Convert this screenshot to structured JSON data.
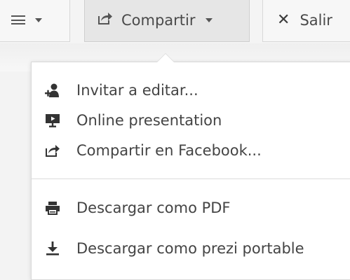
{
  "toolbar": {
    "share_label": "Compartir",
    "exit_label": "Salir"
  },
  "share_menu": {
    "items": [
      {
        "label": "Invitar a editar...",
        "icon": "add-user-icon"
      },
      {
        "label": "Online presentation",
        "icon": "presentation-screen-icon"
      },
      {
        "label": "Compartir en Facebook...",
        "icon": "share-icon"
      },
      {
        "label": "Descargar como PDF",
        "icon": "printer-icon"
      },
      {
        "label": "Descargar como prezi portable",
        "icon": "download-icon"
      }
    ]
  }
}
